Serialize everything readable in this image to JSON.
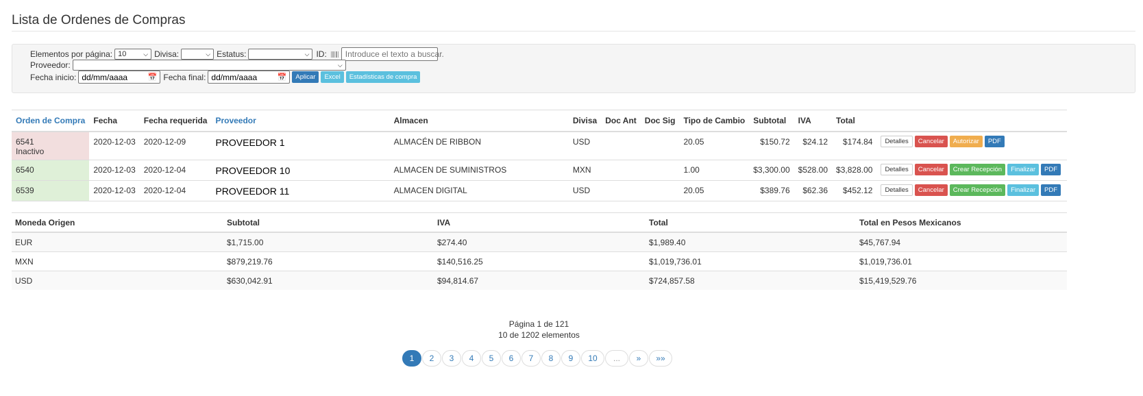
{
  "page": {
    "title": "Lista de Ordenes de Compras"
  },
  "filters": {
    "per_page_label": "Elementos por página:",
    "per_page_value": "10",
    "divisa_label": "Divisa:",
    "divisa_value": "",
    "estatus_label": "Estatus:",
    "estatus_value": "",
    "id_label": "ID:",
    "search_placeholder": "Introduce el texto a buscar.",
    "proveedor_label": "Proveedor:",
    "proveedor_value": "",
    "fecha_inicio_label": "Fecha inicio:",
    "fecha_inicio_placeholder": "dd/mm/aaaa",
    "fecha_final_label": "Fecha final:",
    "fecha_final_placeholder": "dd/mm/aaaa",
    "apply_label": "Aplicar",
    "excel_label": "Excel",
    "stats_label": "Estadísticas de compra"
  },
  "orders": {
    "headers": {
      "order": "Orden de Compra",
      "fecha": "Fecha",
      "fecha_req": "Fecha requerida",
      "proveedor": "Proveedor",
      "almacen": "Almacen",
      "divisa": "Divisa",
      "doc_ant": "Doc Ant",
      "doc_sig": "Doc Sig",
      "tipo_cambio": "Tipo de Cambio",
      "subtotal": "Subtotal",
      "iva": "IVA",
      "total": "Total"
    },
    "rows": [
      {
        "id": "6541",
        "status": "Inactivo",
        "fecha": "2020-12-03",
        "fecha_req": "2020-12-09",
        "proveedor": "PROVEEDOR 1",
        "almacen": "ALMACÉN DE RIBBON",
        "divisa": "USD",
        "doc_ant": "",
        "doc_sig": "",
        "tipo_cambio": "20.05",
        "subtotal": "$150.72",
        "iva": "$24.12",
        "total": "$174.84"
      },
      {
        "id": "6540",
        "status": "",
        "fecha": "2020-12-03",
        "fecha_req": "2020-12-04",
        "proveedor": "PROVEEDOR 10",
        "almacen": "ALMACEN DE SUMINISTROS",
        "divisa": "MXN",
        "doc_ant": "",
        "doc_sig": "",
        "tipo_cambio": "1.00",
        "subtotal": "$3,300.00",
        "iva": "$528.00",
        "total": "$3,828.00"
      },
      {
        "id": "6539",
        "status": "",
        "fecha": "2020-12-03",
        "fecha_req": "2020-12-04",
        "proveedor": "PROVEEDOR 11",
        "almacen": "ALMACEN DIGITAL",
        "divisa": "USD",
        "doc_ant": "",
        "doc_sig": "",
        "tipo_cambio": "20.05",
        "subtotal": "$389.76",
        "iva": "$62.36",
        "total": "$452.12"
      }
    ],
    "actions": {
      "details": "Detalles",
      "cancel": "Cancelar",
      "authorize": "Autorizar",
      "create_reception": "Crear Recepción",
      "finalize": "Finalizar",
      "pdf": "PDF"
    }
  },
  "totals": {
    "headers": {
      "moneda": "Moneda Origen",
      "subtotal": "Subtotal",
      "iva": "IVA",
      "total": "Total",
      "total_mxn": "Total en Pesos Mexicanos"
    },
    "rows": [
      {
        "moneda": "EUR",
        "subtotal": "$1,715.00",
        "iva": "$274.40",
        "total": "$1,989.40",
        "total_mxn": "$45,767.94"
      },
      {
        "moneda": "MXN",
        "subtotal": "$879,219.76",
        "iva": "$140,516.25",
        "total": "$1,019,736.01",
        "total_mxn": "$1,019,736.01"
      },
      {
        "moneda": "USD",
        "subtotal": "$630,042.91",
        "iva": "$94,814.67",
        "total": "$724,857.58",
        "total_mxn": "$15,419,529.76"
      }
    ]
  },
  "pagination": {
    "page_info": "Página 1 de 121",
    "count_info": "10 de 1202 elementos",
    "pages": [
      "1",
      "2",
      "3",
      "4",
      "5",
      "6",
      "7",
      "8",
      "9",
      "10"
    ],
    "ellipsis": "...",
    "next": "»",
    "last": "»»"
  },
  "colors": {
    "primary": "#337ab7",
    "info": "#5bc0de",
    "danger": "#d9534f",
    "success": "#5cb85c",
    "warning": "#f0ad4e",
    "row_inactive": "#f2dede",
    "row_active": "#dff0d8"
  }
}
